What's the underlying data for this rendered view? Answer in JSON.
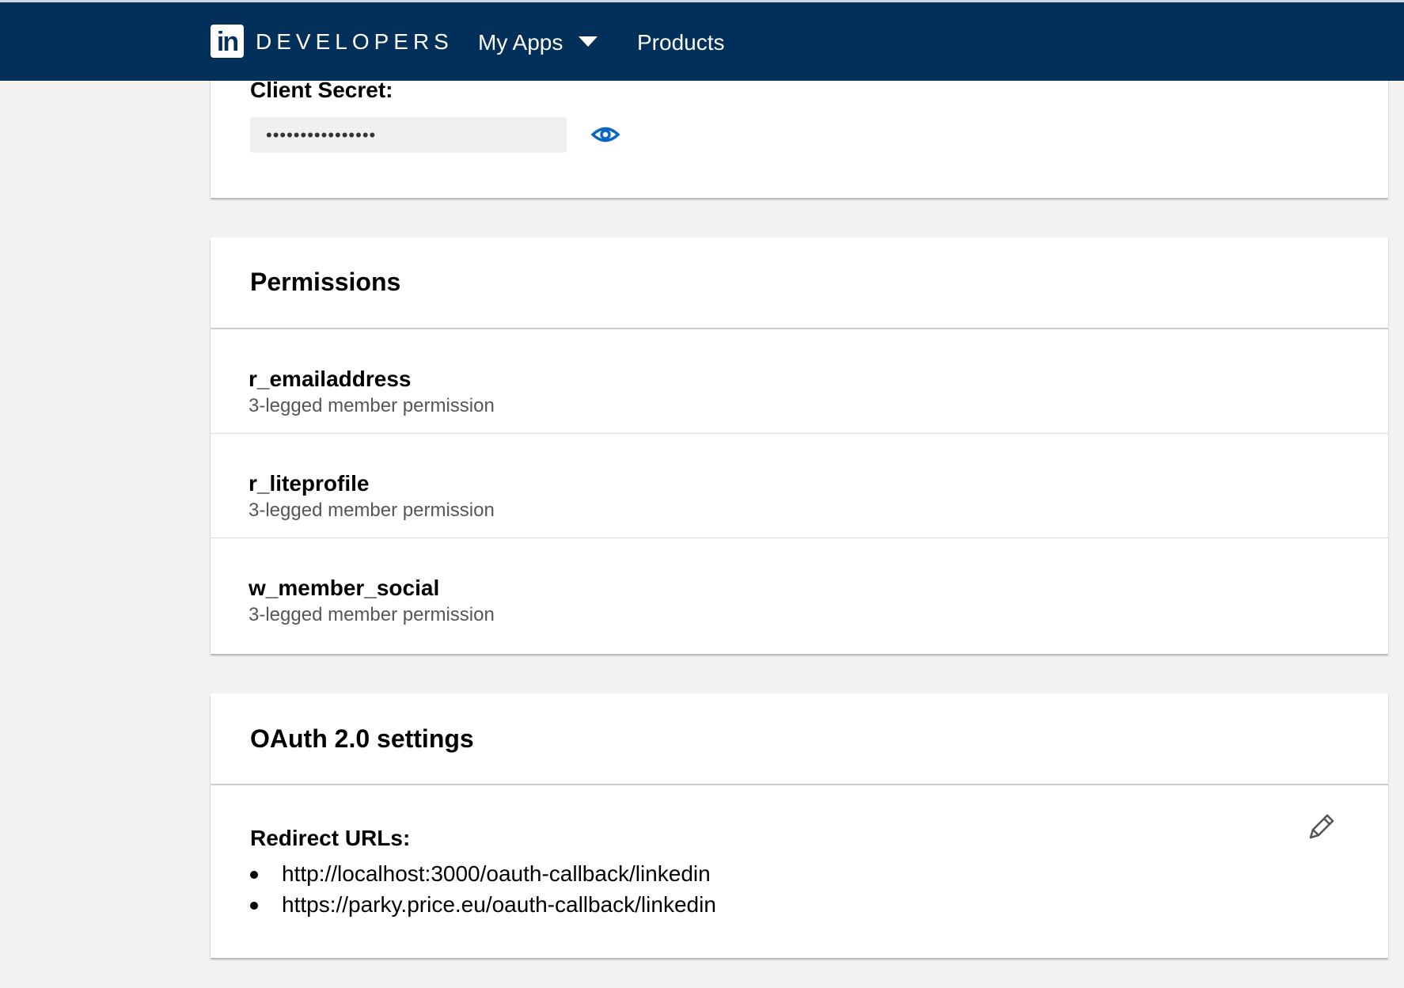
{
  "header": {
    "logo_text": "in",
    "brand": "DEVELOPERS",
    "nav": {
      "my_apps": "My Apps",
      "products": "Products"
    }
  },
  "client_secret": {
    "label": "Client Secret:",
    "masked_value": "••••••••••••••••",
    "toggle_icon": "eye-icon"
  },
  "permissions": {
    "title": "Permissions",
    "items": [
      {
        "name": "r_emailaddress",
        "description": "3-legged member permission"
      },
      {
        "name": "r_liteprofile",
        "description": "3-legged member permission"
      },
      {
        "name": "w_member_social",
        "description": "3-legged member permission"
      }
    ]
  },
  "oauth": {
    "title": "OAuth 2.0 settings",
    "redirect_label": "Redirect URLs:",
    "redirect_urls": [
      "http://localhost:3000/oauth-callback/linkedin",
      "https://parky.price.eu/oauth-callback/linkedin"
    ],
    "edit_icon": "pencil-icon"
  },
  "colors": {
    "header_bg": "#03305a",
    "page_bg": "#f3f2f1",
    "accent_icon": "#0a66c2"
  }
}
